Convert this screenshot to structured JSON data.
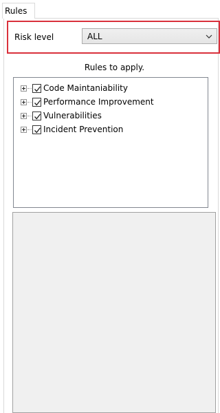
{
  "tab": {
    "label": "Rules"
  },
  "risk": {
    "label": "Risk level",
    "selected": "ALL"
  },
  "rules": {
    "caption": "Rules to apply.",
    "items": [
      {
        "label": "Code Maintaniability",
        "checked": true
      },
      {
        "label": "Performance Improvement",
        "checked": true
      },
      {
        "label": "Vulnerabilities",
        "checked": true
      },
      {
        "label": "Incident Prevention",
        "checked": true
      }
    ]
  },
  "colors": {
    "highlight": "#d9303b",
    "detail_background": "#f0f0f0"
  }
}
